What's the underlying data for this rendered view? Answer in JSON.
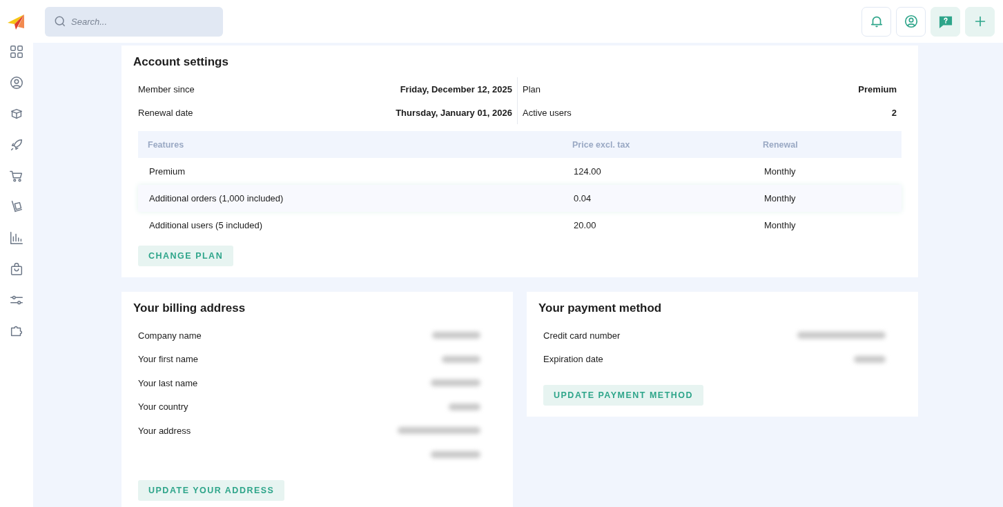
{
  "search": {
    "placeholder": "Search..."
  },
  "sidebar": {
    "items": [
      {
        "selected": false
      },
      {
        "selected": false
      },
      {
        "selected": false
      },
      {
        "selected": false
      },
      {
        "selected": false
      },
      {
        "selected": false
      },
      {
        "selected": false
      },
      {
        "selected": false
      },
      {
        "selected": false
      },
      {
        "selected": false
      }
    ]
  },
  "account": {
    "title": "Account settings",
    "left": [
      {
        "label": "Member since",
        "value": "Friday, December 12, 2025"
      },
      {
        "label": "Renewal date",
        "value": "Thursday, January 01, 2026"
      }
    ],
    "right": [
      {
        "label": "Plan",
        "value": "Premium"
      },
      {
        "label": "Active users",
        "value": "2"
      }
    ],
    "table": {
      "columns": [
        "Features",
        "Price excl. tax",
        "Renewal"
      ],
      "rows": [
        {
          "cells": [
            "Premium",
            "124.00",
            "Monthly"
          ],
          "selected": false
        },
        {
          "cells": [
            "Additional orders (1,000 included)",
            "0.04",
            "Monthly"
          ],
          "selected": true
        },
        {
          "cells": [
            "Additional users (5 included)",
            "20.00",
            "Monthly"
          ],
          "selected": false
        }
      ]
    },
    "button": "CHANGE PLAN"
  },
  "billing": {
    "title": "Your billing address",
    "fields": [
      {
        "label": "Company name"
      },
      {
        "label": "Your first name"
      },
      {
        "label": "Your last name"
      },
      {
        "label": "Your country"
      },
      {
        "label": "Your address"
      }
    ],
    "button": "UPDATE YOUR ADDRESS"
  },
  "payment": {
    "title": "Your payment method",
    "fields": [
      {
        "label": "Credit card number"
      },
      {
        "label": "Expiration date"
      }
    ],
    "button": "UPDATE PAYMENT METHOD"
  }
}
